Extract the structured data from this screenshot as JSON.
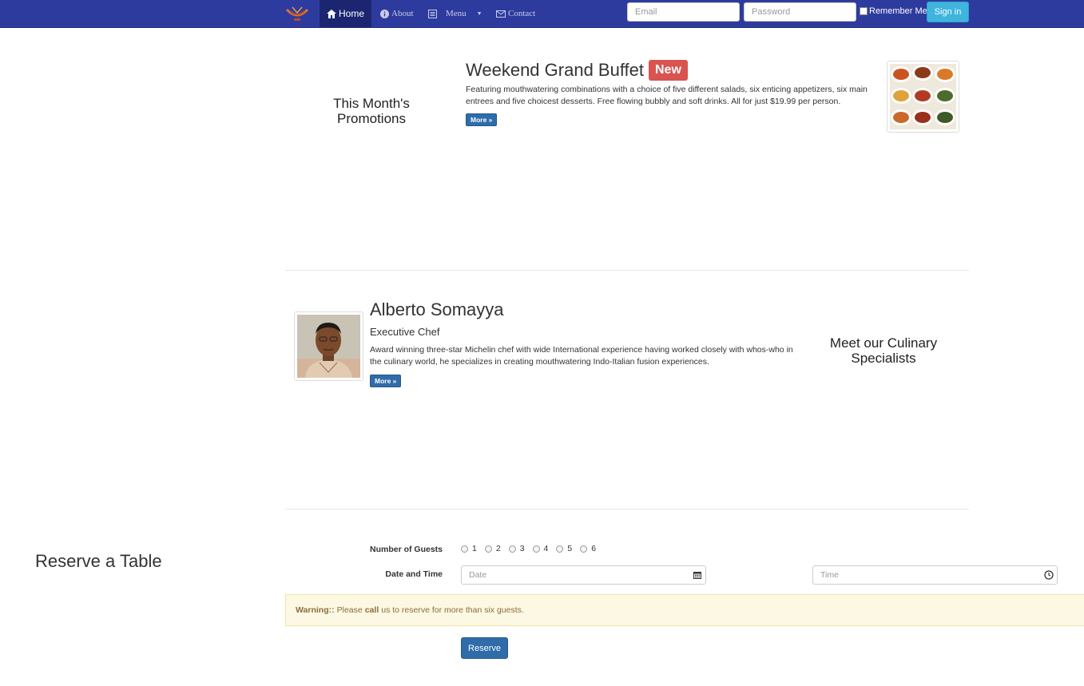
{
  "nav": {
    "home_label": "Home",
    "about_label": "About",
    "menu_label": "Menu",
    "contact_label": "Contact",
    "email_placeholder": "Email",
    "password_placeholder": "Password",
    "remember_label": "Remember Me",
    "signin_label": "Sign in"
  },
  "promotions": {
    "heading": "This Month's Promotions",
    "title": "Weekend Grand Buffet",
    "badge": "New",
    "description": "Featuring mouthwatering combinations with a choice of five different salads, six enticing appetizers, six main entrees and five choicest desserts. Free flowing bubbly and soft drinks. All for just $19.99 per person.",
    "more_label": "More »"
  },
  "specialists": {
    "heading": "Meet our Culinary Specialists",
    "name": "Alberto Somayya",
    "role": "Executive Chef",
    "description": "Award winning three-star Michelin chef with wide International experience having worked closely with whos-who in the culinary world, he specializes in creating mouthwatering Indo-Italian fusion experiences.",
    "more_label": "More »"
  },
  "reservation": {
    "heading": "Reserve a Table",
    "guests_label": "Number of Guests",
    "guest_options": [
      "1",
      "2",
      "3",
      "4",
      "5",
      "6"
    ],
    "datetime_label": "Date and Time",
    "date_placeholder": "Date",
    "time_placeholder": "Time",
    "warning_prefix": "Warning::",
    "warning_pre": "Please",
    "warning_call": "call",
    "warning_post": "us to reserve for more than six guests.",
    "reserve_label": "Reserve"
  },
  "colors": {
    "navbar": "#2e3b9e",
    "active_nav": "#1c2670",
    "signin": "#3fb5dd",
    "primary": "#2f6ca9",
    "badge": "#d9534f",
    "warning_bg": "#fcf8e3"
  }
}
